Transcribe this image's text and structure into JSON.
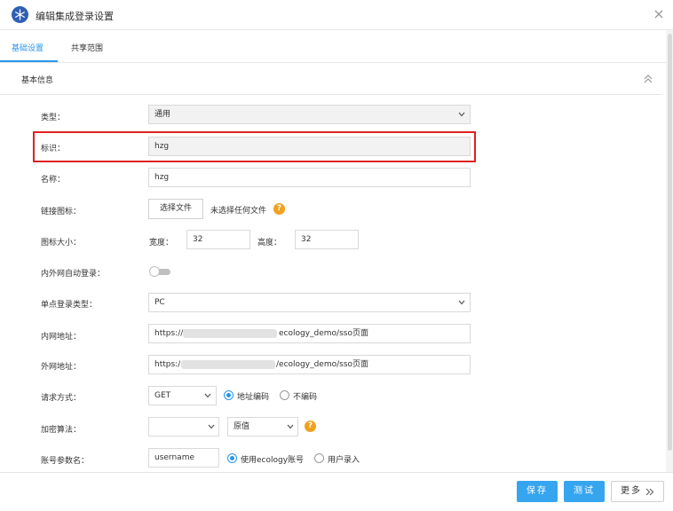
{
  "window": {
    "title": "编辑集成登录设置",
    "icon": "snowflake-icon",
    "close_icon": "close-icon"
  },
  "tabs": [
    {
      "label": "基础设置",
      "active": true
    },
    {
      "label": "共享范围",
      "active": false
    }
  ],
  "section": {
    "title": "基本信息",
    "icon": "double-chevron-up-icon"
  },
  "form": {
    "type": {
      "label": "类型：",
      "value": "通用"
    },
    "identifier": {
      "label": "标识：",
      "value": "hzg"
    },
    "name": {
      "label": "名称：",
      "value": "hzg"
    },
    "link_icon": {
      "label": "链接图标：",
      "button": "选择文件",
      "status": "未选择任何文件",
      "help": "?"
    },
    "icon_size": {
      "label": "图标大小：",
      "width_label": "宽度：",
      "width_value": "32",
      "height_label": "高度：",
      "height_value": "32"
    },
    "auto_login": {
      "label": "内外网自动登录：",
      "enabled": false
    },
    "sso_type": {
      "label": "单点登录类型：",
      "value": "PC"
    },
    "intranet_url": {
      "label": "内网地址：",
      "prefix": "https://",
      "suffix": "ecology_demo/sso页面"
    },
    "extranet_url": {
      "label": "外网地址：",
      "prefix": "https:/",
      "suffix": "/ecology_demo/sso页面"
    },
    "request_method": {
      "label": "请求方式：",
      "value": "GET",
      "options": [
        {
          "label": "地址编码",
          "checked": true
        },
        {
          "label": "不编码",
          "checked": false
        }
      ]
    },
    "encryption": {
      "label": "加密算法：",
      "value1": "",
      "value2": "原值",
      "help": "?"
    },
    "account_param": {
      "label": "账号参数名：",
      "value": "username",
      "options": [
        {
          "label": "使用ecology账号",
          "checked": true
        },
        {
          "label": "用户录入",
          "checked": false
        }
      ]
    }
  },
  "footer": {
    "save": "保存",
    "test": "测试",
    "more": "更多"
  },
  "colors": {
    "accent": "#2b96ea",
    "primary_button": "#36a5f0",
    "highlight": "#e02020",
    "help": "#f0a11e"
  }
}
